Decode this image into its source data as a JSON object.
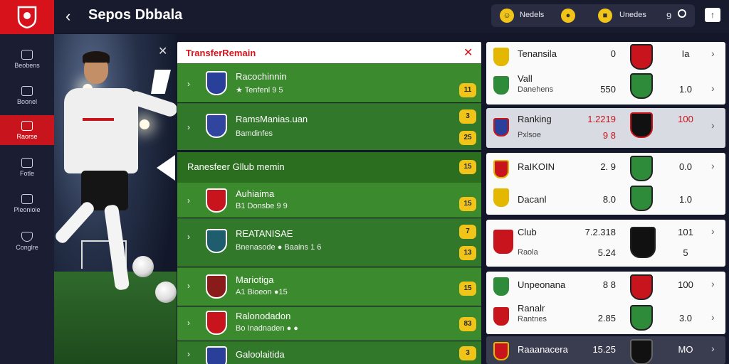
{
  "header": {
    "title": "Sepos Dbbala",
    "pill_label_1": "Nedels",
    "pill_label_2": "Unedes",
    "pill_value": "9",
    "back_icon": "chevron-left-icon",
    "search_icon": "search-icon",
    "share_icon": "share-icon"
  },
  "sidebar": {
    "items": [
      {
        "label": "Beobens",
        "icon": "home-icon"
      },
      {
        "label": "Boonel",
        "icon": "bag-icon"
      },
      {
        "label": "Raorse",
        "icon": "folder-icon"
      },
      {
        "label": "Fotle",
        "icon": "doc-icon"
      },
      {
        "label": "Pleonioie",
        "icon": "image-icon"
      },
      {
        "label": "Conglre",
        "icon": "shield-icon"
      }
    ]
  },
  "transfer": {
    "header_title": "TransferRemain",
    "rows": [
      {
        "name": "Racochinnin",
        "sub": "★ Tenfenl 9 5",
        "num": "11"
      },
      {
        "name": "RamsManias.uan",
        "sub": "Bamdinfes",
        "num": "3",
        "num2": "25"
      },
      {
        "section": true,
        "name": "Ranesfeer Gllub memin",
        "num": "15"
      },
      {
        "name": "Auhiaima",
        "sub": "B1 Donsbe   9  9",
        "num": "15"
      },
      {
        "name": "REATANISAE",
        "sub": "Bnenasode  ● Baains 1 6",
        "num": "7",
        "num2": "13"
      },
      {
        "name": "Mariotiga",
        "sub": "A1 Bioeon  ●15",
        "num": "15"
      },
      {
        "name": "Ralonodadon",
        "sub": "Bo Inadnaden ● ●",
        "num": "83"
      },
      {
        "name": "Galoolaitida",
        "sub": "",
        "num": "3"
      }
    ]
  },
  "ranking": {
    "cards": [
      {
        "style": "light",
        "lines": [
          {
            "name": "Tenansila",
            "sub": "",
            "score": "0",
            "val": "Ia",
            "badge_color": "#e4b800",
            "crest_color": "#c8141c"
          },
          {
            "name": "Vall",
            "sub": "Danehens",
            "score": "550",
            "val": "1.0",
            "badge_color": "#2e8b3a",
            "crest_color": "#2e8b3a"
          }
        ]
      },
      {
        "style": "grey",
        "lines": [
          {
            "name": "Ranking",
            "sub": "Pxlsoe",
            "score": "1.2219",
            "score2": "9 8",
            "val": "100",
            "badge_color": "#2a3f9a",
            "crest_color": "#111"
          }
        ]
      },
      {
        "style": "light",
        "lines": [
          {
            "name": "RaIKOIN",
            "sub": "",
            "score": "2. 9",
            "val": "0.0",
            "badge_color": "#c8141c",
            "crest_color": "#2e8b3a"
          },
          {
            "name": "Dacanl",
            "sub": "",
            "score": "8.0",
            "val": "1.0",
            "badge_color": "#e4b800",
            "crest_color": "#2e8b3a"
          }
        ]
      },
      {
        "style": "light",
        "lines": [
          {
            "name": "Club",
            "sub": "Raola",
            "score": "7.2.318",
            "score2": "5.24",
            "val": "101",
            "val2": "5",
            "badge_color": "#c8141c",
            "crest_color": "#111"
          }
        ]
      },
      {
        "style": "light",
        "lines": [
          {
            "name": "Unpeonana",
            "sub": "",
            "score": "8  8",
            "val": "100",
            "badge_color": "#2e8b3a",
            "crest_color": "#c8141c"
          },
          {
            "name": "Ranalr",
            "sub": "Rantnes",
            "score": "2.85",
            "val": "3.0",
            "badge_color": "#c8141c",
            "crest_color": "#2e8b3a"
          }
        ]
      },
      {
        "style": "dark",
        "lines": [
          {
            "name": "Raaanacera",
            "sub": "",
            "score": "15.25",
            "val": "MO",
            "badge_color": "#c8141c",
            "crest_color": "#111"
          }
        ]
      }
    ]
  }
}
